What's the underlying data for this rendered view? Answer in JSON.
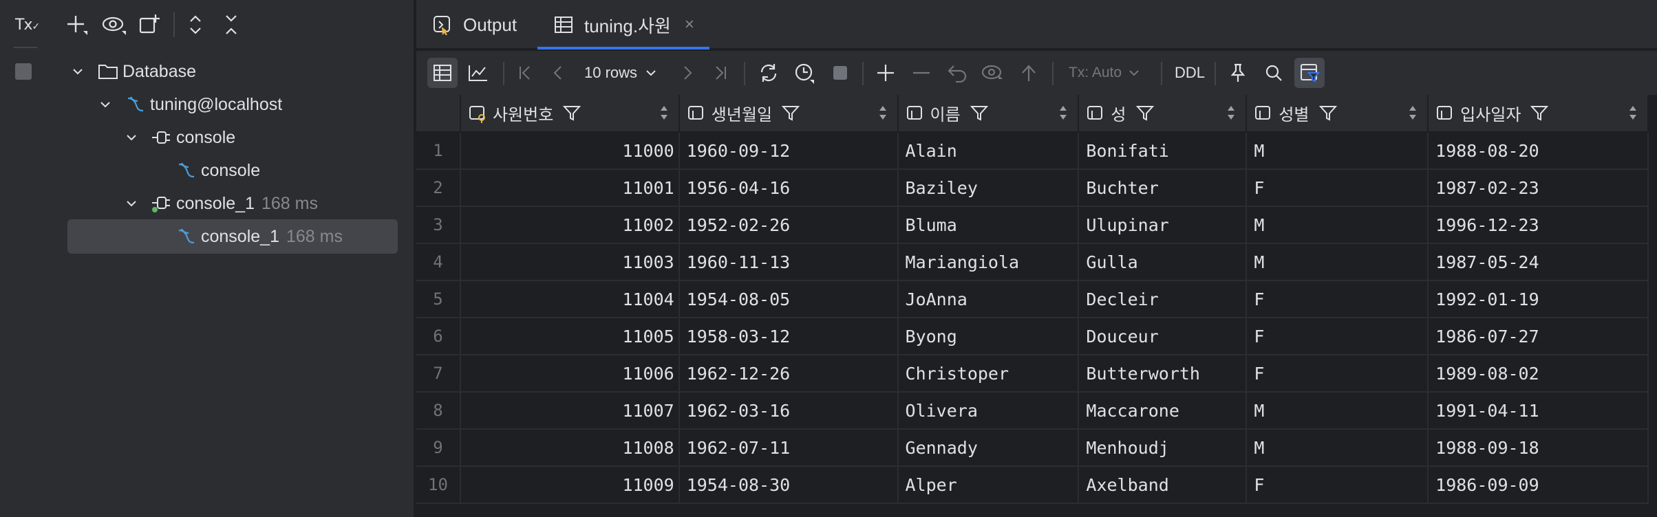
{
  "left_panel": {
    "tx_label": "Tx",
    "toolbar_icons": [
      "add-icon",
      "view-icon",
      "new-session-icon",
      "expand-all-icon",
      "collapse-all-icon"
    ],
    "tree": [
      {
        "label": "Database",
        "muted": "",
        "icon": "folder-icon"
      },
      {
        "label": "tuning@localhost",
        "muted": "",
        "icon": "mysql-icon"
      },
      {
        "label": "console",
        "muted": "",
        "icon": "session-icon"
      },
      {
        "label": "console",
        "muted": "",
        "icon": "mysql-icon"
      },
      {
        "label": "console_1",
        "muted": "168 ms",
        "icon": "session-active-icon"
      },
      {
        "label": "console_1",
        "muted": "168 ms",
        "icon": "mysql-icon"
      }
    ]
  },
  "tabs": [
    {
      "label": "Output",
      "active": false
    },
    {
      "label": "tuning.사원",
      "active": true,
      "close": "×"
    }
  ],
  "toolbar": {
    "rows_label": "10 rows",
    "tx_mode": "Tx: Auto",
    "ddl_label": "DDL"
  },
  "grid": {
    "columns": [
      "사원번호",
      "생년월일",
      "이름",
      "성",
      "성별",
      "입사일자"
    ],
    "rows": [
      {
        "n": "1",
        "cells": [
          "11000",
          "1960-09-12",
          "Alain",
          "Bonifati",
          "M",
          "1988-08-20"
        ]
      },
      {
        "n": "2",
        "cells": [
          "11001",
          "1956-04-16",
          "Baziley",
          "Buchter",
          "F",
          "1987-02-23"
        ]
      },
      {
        "n": "3",
        "cells": [
          "11002",
          "1952-02-26",
          "Bluma",
          "Ulupinar",
          "M",
          "1996-12-23"
        ]
      },
      {
        "n": "4",
        "cells": [
          "11003",
          "1960-11-13",
          "Mariangiola",
          "Gulla",
          "M",
          "1987-05-24"
        ]
      },
      {
        "n": "5",
        "cells": [
          "11004",
          "1954-08-05",
          "JoAnna",
          "Decleir",
          "F",
          "1992-01-19"
        ]
      },
      {
        "n": "6",
        "cells": [
          "11005",
          "1958-03-12",
          "Byong",
          "Douceur",
          "F",
          "1986-07-27"
        ]
      },
      {
        "n": "7",
        "cells": [
          "11006",
          "1962-12-26",
          "Christoper",
          "Butterworth",
          "F",
          "1989-08-02"
        ]
      },
      {
        "n": "8",
        "cells": [
          "11007",
          "1962-03-16",
          "Olivera",
          "Maccarone",
          "M",
          "1991-04-11"
        ]
      },
      {
        "n": "9",
        "cells": [
          "11008",
          "1962-07-11",
          "Gennady",
          "Menhoudj",
          "M",
          "1988-09-18"
        ]
      },
      {
        "n": "10",
        "cells": [
          "11009",
          "1954-08-30",
          "Alper",
          "Axelband",
          "F",
          "1986-09-09"
        ]
      }
    ]
  },
  "colors": {
    "accent": "#3574f0",
    "panel": "#2b2d30",
    "editor": "#1e1f22",
    "mysql": "#4a9eda"
  }
}
